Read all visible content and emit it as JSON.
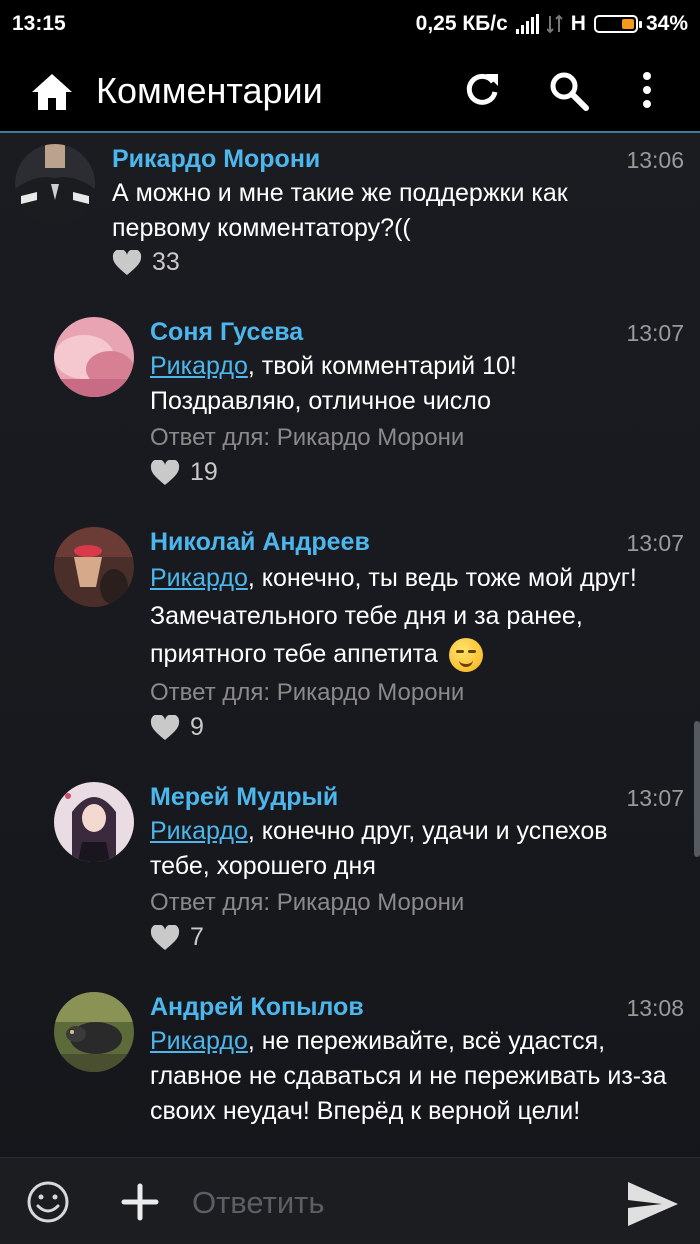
{
  "status": {
    "time": "13:15",
    "speed": "0,25 КБ/с",
    "network": "H",
    "battery": "34%"
  },
  "appbar": {
    "title": "Комментарии",
    "icons": [
      "home-icon",
      "refresh-icon",
      "search-icon",
      "more-vert-icon"
    ]
  },
  "comments": [
    {
      "author": "Рикардо Морони",
      "time": "13:06",
      "text": "А можно и мне такие же поддержки как первому комментатору?((",
      "likes": "33"
    },
    {
      "author": "Соня Гусева",
      "time": "13:07",
      "mention": "Рикардо",
      "text": ", твой комментарий 10! Поздравляю, отличное число",
      "reply_to": "Ответ для: Рикардо Морони",
      "likes": "19"
    },
    {
      "author": "Николай Андреев",
      "time": "13:07",
      "mention": "Рикардо",
      "text": ", конечно, ты ведь тоже мой друг! Замечательного тебе дня и за ранее, приятного тебе аппетита",
      "emoji": "smirk-emoji",
      "reply_to": "Ответ для: Рикардо Морони",
      "likes": "9"
    },
    {
      "author": "Мерей Мудрый",
      "time": "13:07",
      "mention": "Рикардо",
      "text": ", конечно друг, удачи и успехов тебе, хорошего дня",
      "reply_to": "Ответ для: Рикардо Морони",
      "likes": "7"
    },
    {
      "author": "Андрей Копылов",
      "time": "13:08",
      "mention": "Рикардо",
      "text": ", не переживайте, всё удастся, главное не сдаваться и не переживать из-за своих неудач! Вперёд к верной цели!"
    }
  ],
  "composer": {
    "placeholder": "Ответить"
  },
  "colors": {
    "accent": "#4db6ec",
    "background": "#181a1f",
    "bar": "#000000"
  }
}
